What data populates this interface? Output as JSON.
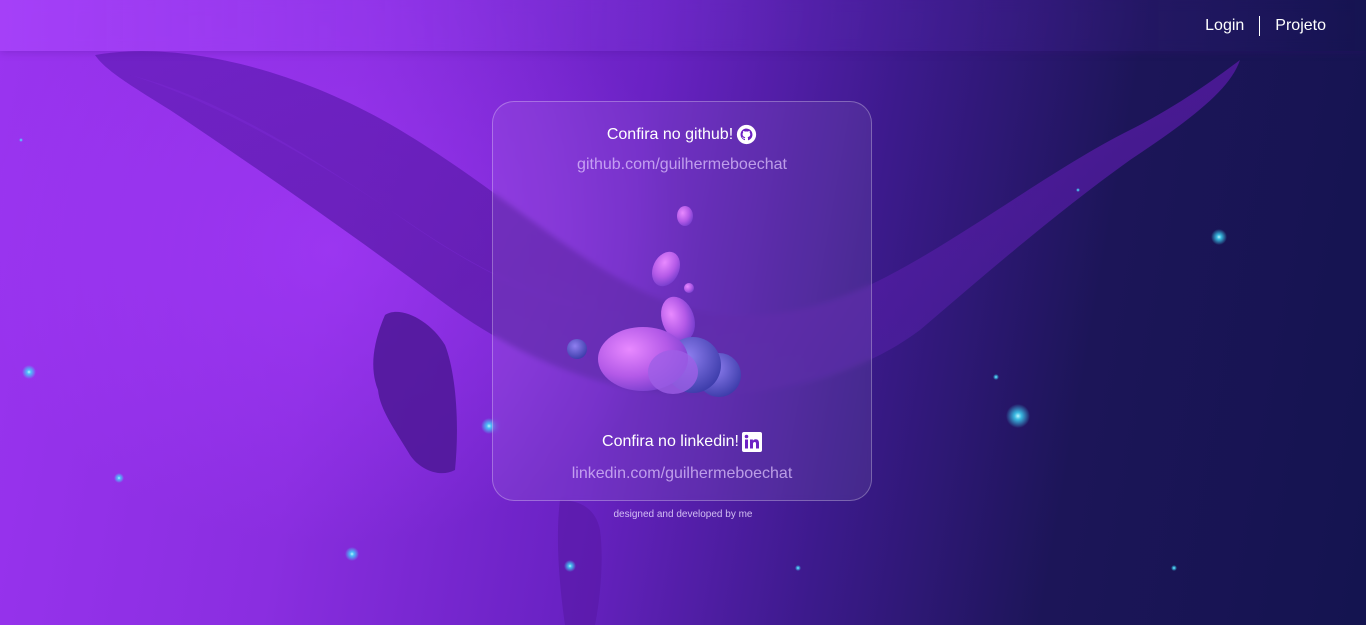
{
  "nav": {
    "login_label": "Login",
    "project_label": "Projeto"
  },
  "card": {
    "github_heading": "Confira no github!",
    "github_icon": "github-icon",
    "github_link": "github.com/guilhermeboechat",
    "linkedin_heading": "Confira no linkedin!",
    "linkedin_icon": "linkedin-icon",
    "linkedin_link": "linkedin.com/guilhermeboechat"
  },
  "footer": {
    "credit": "designed and developed by me"
  },
  "colors": {
    "background_left": "#9a34f0",
    "background_right": "#141450",
    "link_text": "#e1c8ff",
    "accent_glow": "#3ee0ff"
  }
}
